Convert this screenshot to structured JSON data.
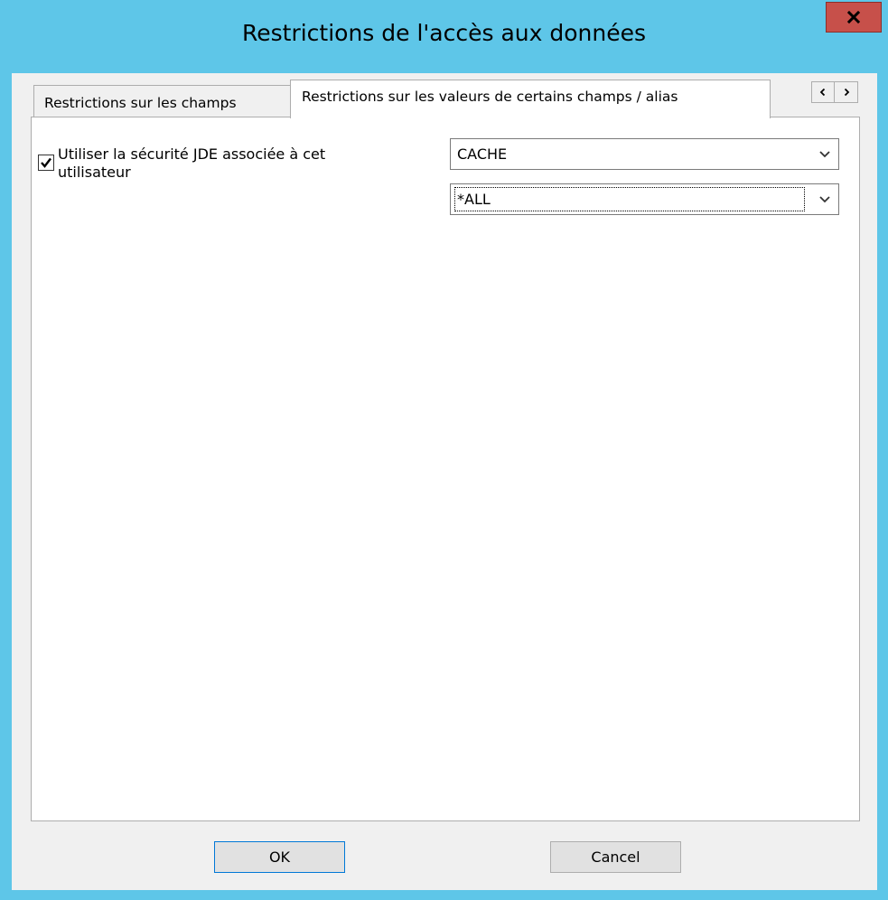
{
  "window": {
    "title": "Restrictions de l'accès aux données",
    "close_label": "x"
  },
  "tabs": [
    {
      "label": "Restrictions sur les champs",
      "active": false
    },
    {
      "label": "Restrictions sur les valeurs de certains champs / alias",
      "active": true
    }
  ],
  "tab_scroll": {
    "left_icon": "chevron-left-icon",
    "right_icon": "chevron-right-icon"
  },
  "panel": {
    "use_jde_security": {
      "label": "Utiliser la sécurité JDE associée à cet utilisateur",
      "checked": true
    },
    "combo_1": {
      "value": "CACHE"
    },
    "combo_2": {
      "value": "*ALL"
    }
  },
  "buttons": {
    "ok": "OK",
    "cancel": "Cancel"
  },
  "colors": {
    "frame": "#5ec6e8",
    "close": "#c7504a",
    "client": "#f0f0f0",
    "panel": "#ffffff",
    "focus_border": "#0078d7"
  }
}
